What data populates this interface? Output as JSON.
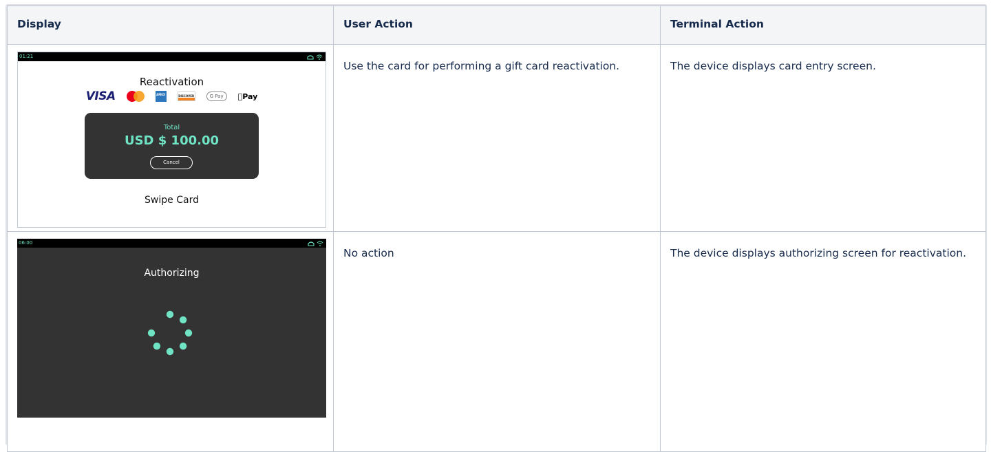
{
  "table": {
    "headers": [
      "Display",
      "User Action",
      "Terminal Action"
    ],
    "rows": [
      {
        "user_action": "Use the card for performing a gift card reactivation.",
        "terminal_action": "The device displays card entry screen."
      },
      {
        "user_action": "No action",
        "terminal_action": "The device displays authorizing screen for reactivation."
      }
    ]
  },
  "screen_card_entry": {
    "time": "01:21",
    "title": "Reactivation",
    "brands": [
      "VISA",
      "Mastercard",
      "AMEX",
      "DISCOVER",
      "G Pay",
      "Pay"
    ],
    "total_label": "Total",
    "total_value": "USD $ 100.00",
    "cancel_label": "Cancel",
    "prompt": "Swipe Card",
    "accent_color": "#6fe3c4"
  },
  "screen_authorizing": {
    "time": "06:00",
    "title": "Authorizing",
    "spinner_color": "#6fe3c4",
    "background_color": "#333333"
  }
}
